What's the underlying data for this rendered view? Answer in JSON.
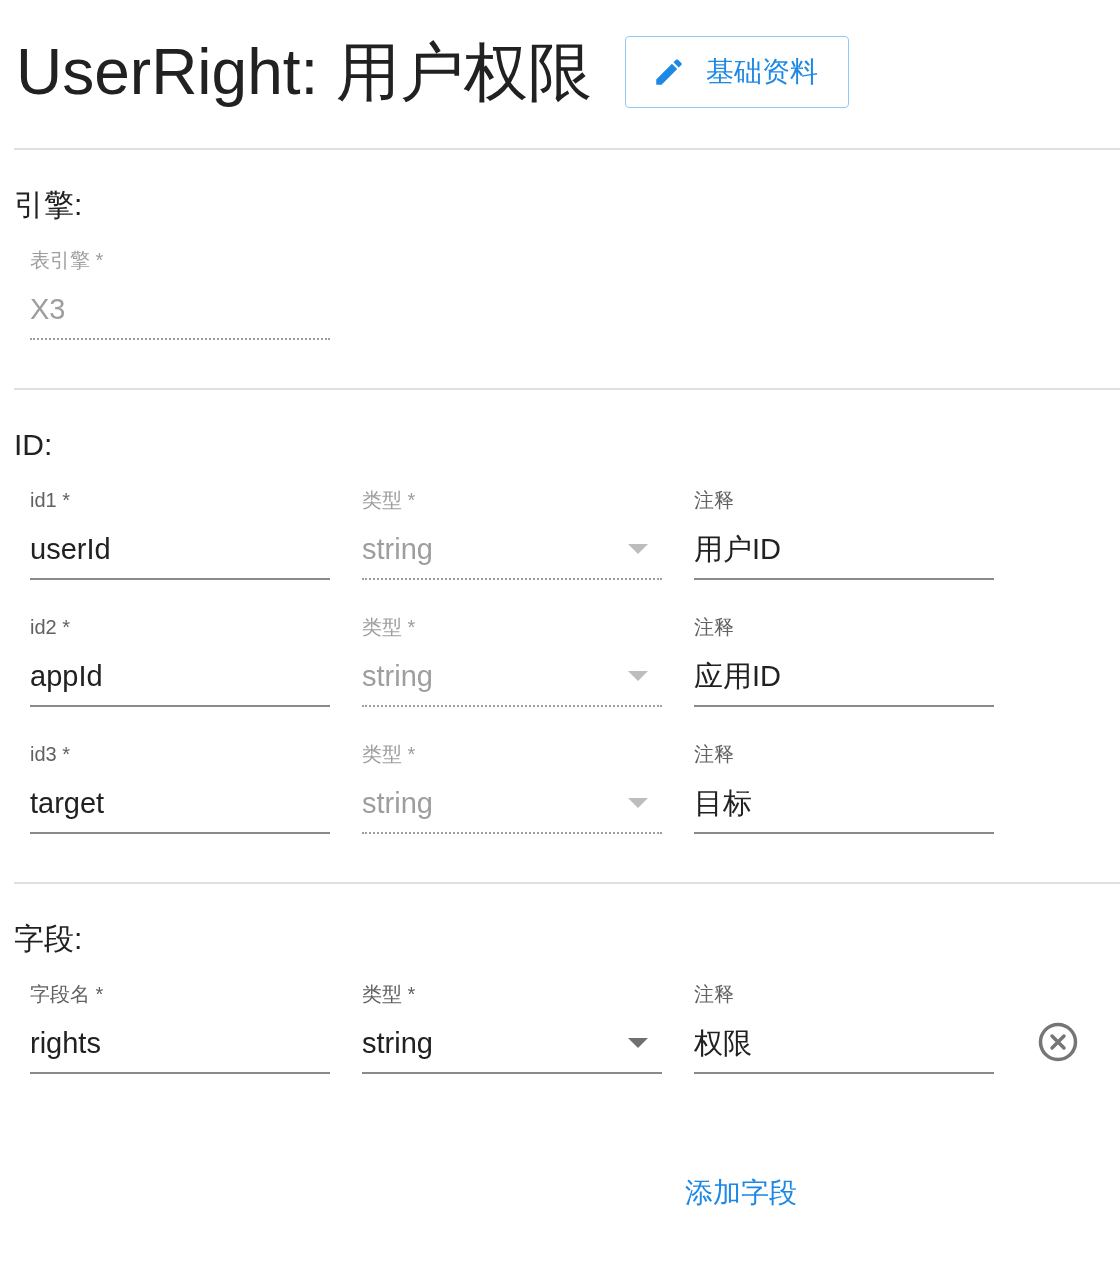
{
  "title": "UserRight: 用户权限",
  "edit_button": {
    "label": "基础资料"
  },
  "sections": [
    {
      "heading": "引擎:",
      "rows": [
        {
          "fields": [
            {
              "kind": "text",
              "label": "表引擎 *",
              "value": "X3",
              "disabled": true
            }
          ]
        }
      ]
    },
    {
      "heading": "ID:",
      "rows": [
        {
          "fields": [
            {
              "kind": "text",
              "label": "id1 *",
              "value": "userId",
              "disabled": false
            },
            {
              "kind": "select",
              "label": "类型 *",
              "value": "string",
              "disabled": true
            },
            {
              "kind": "text",
              "label": "注释",
              "value": "用户ID",
              "disabled": false
            }
          ]
        },
        {
          "fields": [
            {
              "kind": "text",
              "label": "id2 *",
              "value": "appId",
              "disabled": false
            },
            {
              "kind": "select",
              "label": "类型 *",
              "value": "string",
              "disabled": true
            },
            {
              "kind": "text",
              "label": "注释",
              "value": "应用ID",
              "disabled": false
            }
          ]
        },
        {
          "fields": [
            {
              "kind": "text",
              "label": "id3 *",
              "value": "target",
              "disabled": false
            },
            {
              "kind": "select",
              "label": "类型 *",
              "value": "string",
              "disabled": true
            },
            {
              "kind": "text",
              "label": "注释",
              "value": "目标",
              "disabled": false
            }
          ]
        }
      ]
    },
    {
      "heading": "字段:",
      "rows": [
        {
          "removable": true,
          "fields": [
            {
              "kind": "text",
              "label": "字段名 *",
              "value": "rights",
              "disabled": false
            },
            {
              "kind": "select",
              "label": "类型 *",
              "value": "string",
              "disabled": false
            },
            {
              "kind": "text",
              "label": "注释",
              "value": "权限",
              "disabled": false
            }
          ]
        }
      ],
      "add_link": "添加字段"
    }
  ]
}
